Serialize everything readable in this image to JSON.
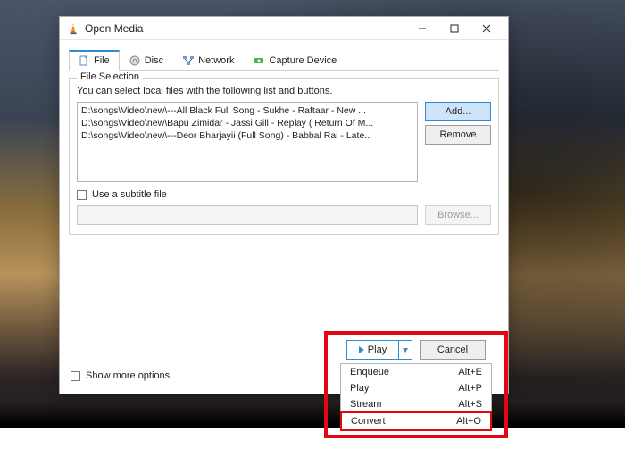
{
  "window": {
    "title": "Open Media"
  },
  "tabs": {
    "file": "File",
    "disc": "Disc",
    "network": "Network",
    "capture": "Capture Device"
  },
  "file_selection": {
    "legend": "File Selection",
    "hint": "You can select local files with the following list and buttons.",
    "items": [
      "D:\\songs\\Video\\new\\---All Black Full Song - Sukhe - Raftaar -  New ...",
      "D:\\songs\\Video\\new\\Bapu Zimidar - Jassi Gill - Replay ( Return Of M...",
      "D:\\songs\\Video\\new\\---Deor Bharjayii (Full Song) - Babbal Rai - Late..."
    ],
    "add_label": "Add...",
    "remove_label": "Remove"
  },
  "subtitle": {
    "checkbox_label": "Use a subtitle file",
    "browse_label": "Browse..."
  },
  "more_options_label": "Show more options",
  "actions": {
    "play_label": "Play",
    "cancel_label": "Cancel"
  },
  "play_menu": [
    {
      "label": "Enqueue",
      "shortcut": "Alt+E"
    },
    {
      "label": "Play",
      "shortcut": "Alt+P"
    },
    {
      "label": "Stream",
      "shortcut": "Alt+S"
    },
    {
      "label": "Convert",
      "shortcut": "Alt+O"
    }
  ]
}
